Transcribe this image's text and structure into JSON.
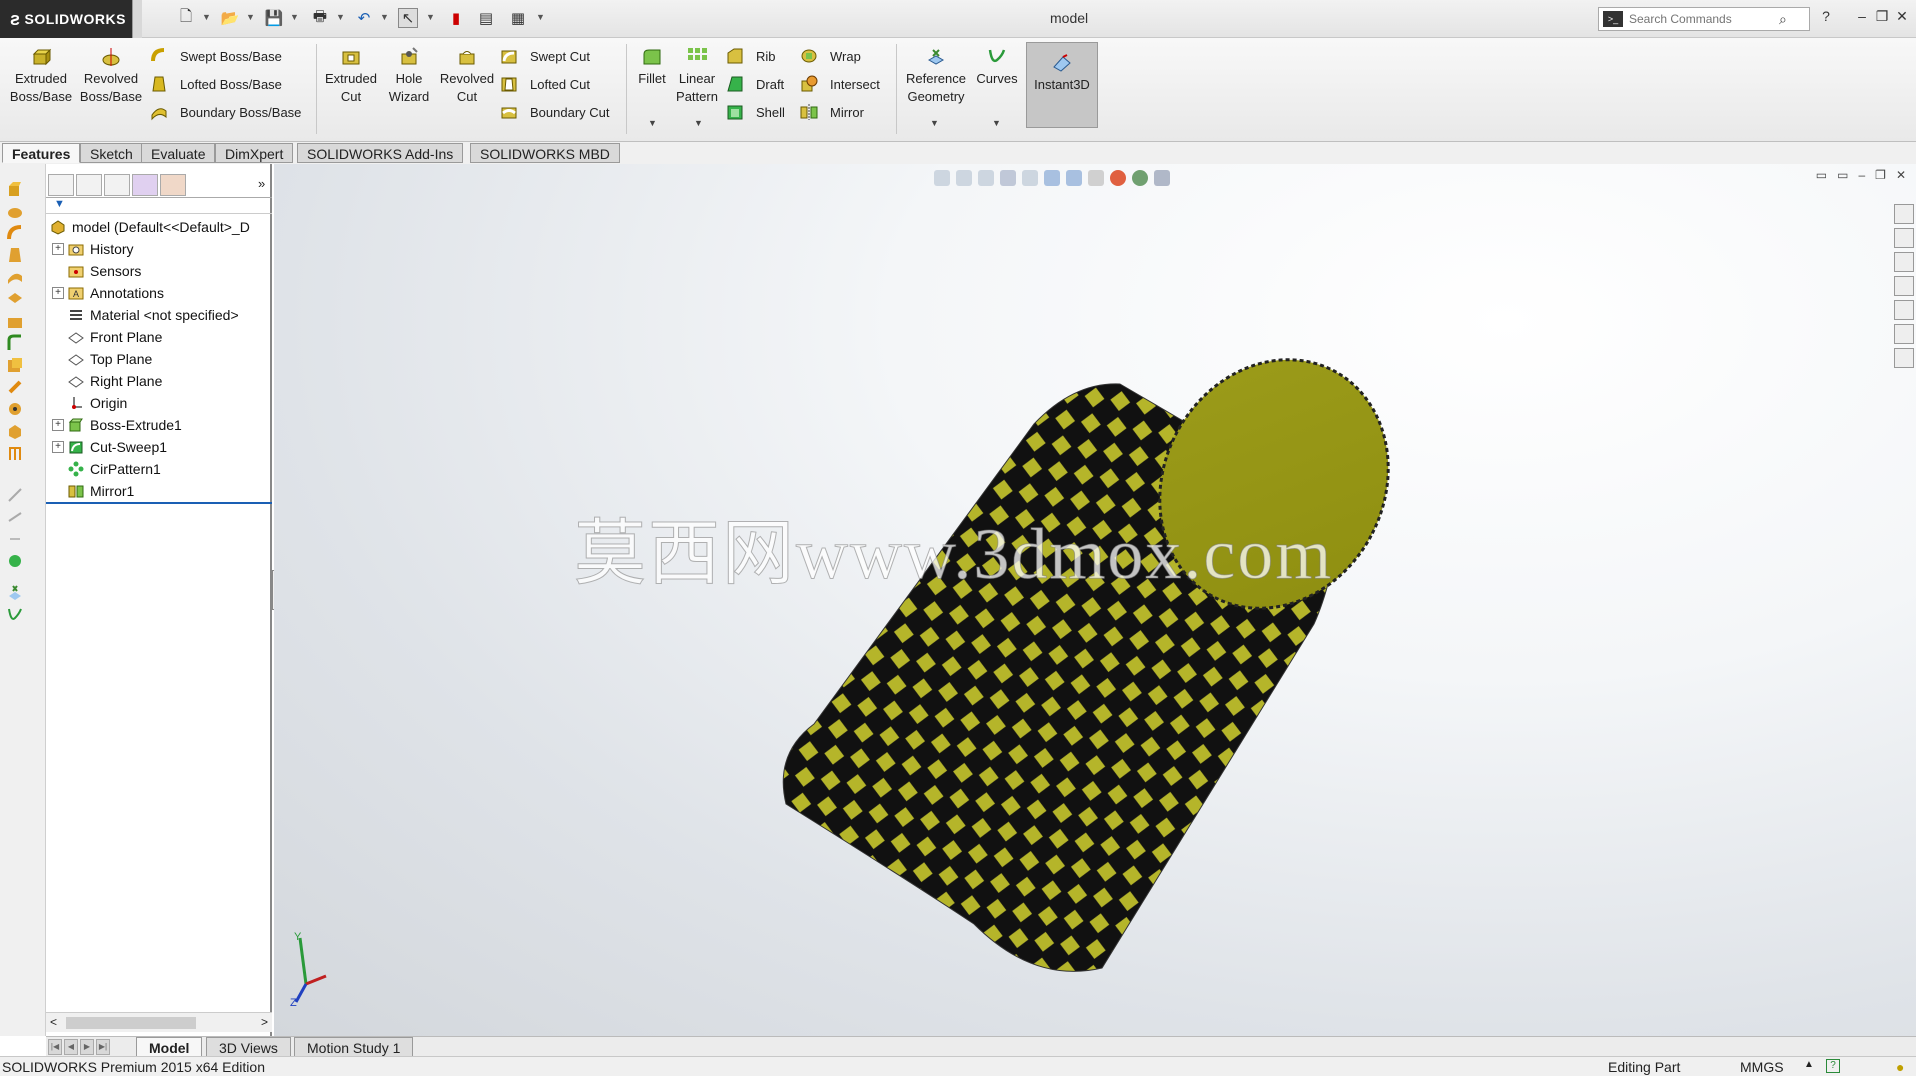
{
  "app": {
    "brand": "SOLIDWORKS",
    "title": "model"
  },
  "search": {
    "placeholder": "Search Commands"
  },
  "ribbon": {
    "extruded_boss": "Extruded Boss/Base",
    "revolved_boss": "Revolved Boss/Base",
    "swept_boss": "Swept Boss/Base",
    "lofted_boss": "Lofted Boss/Base",
    "boundary_boss": "Boundary Boss/Base",
    "extruded_cut": "Extruded Cut",
    "hole_wizard": "Hole Wizard",
    "revolved_cut": "Revolved Cut",
    "swept_cut": "Swept Cut",
    "lofted_cut": "Lofted Cut",
    "boundary_cut": "Boundary Cut",
    "fillet": "Fillet",
    "linear_pattern": "Linear Pattern",
    "rib": "Rib",
    "draft": "Draft",
    "shell": "Shell",
    "wrap": "Wrap",
    "intersect": "Intersect",
    "mirror": "Mirror",
    "reference_geometry": "Reference Geometry",
    "curves": "Curves",
    "instant3d": "Instant3D"
  },
  "cm_tabs": [
    "Features",
    "Sketch",
    "Evaluate",
    "DimXpert",
    "SOLIDWORKS Add-Ins",
    "SOLIDWORKS MBD"
  ],
  "tree": {
    "root": "model  (Default<<Default>_D",
    "items": [
      {
        "label": "History",
        "expandable": true
      },
      {
        "label": "Sensors",
        "expandable": false
      },
      {
        "label": "Annotations",
        "expandable": true
      },
      {
        "label": "Material <not specified>",
        "expandable": false
      },
      {
        "label": "Front Plane",
        "expandable": false
      },
      {
        "label": "Top Plane",
        "expandable": false
      },
      {
        "label": "Right Plane",
        "expandable": false
      },
      {
        "label": "Origin",
        "expandable": false
      },
      {
        "label": "Boss-Extrude1",
        "expandable": true
      },
      {
        "label": "Cut-Sweep1",
        "expandable": true
      },
      {
        "label": "CirPattern1",
        "expandable": false
      },
      {
        "label": "Mirror1",
        "expandable": false
      }
    ]
  },
  "watermark": "莫西网www.3dmox.com",
  "triad": {
    "y_label": "Y",
    "z_label": "Z"
  },
  "bottom_tabs": [
    "Model",
    "3D Views",
    "Motion Study 1"
  ],
  "status": {
    "edition": "SOLIDWORKS Premium 2015 x64 Edition",
    "mode": "Editing Part",
    "units": "MMGS"
  },
  "colors": {
    "part_yellow": "#b5b52a",
    "part_shadow": "#6f6f10",
    "knurl_black": "#111111",
    "accent_blue": "#1a5fb4"
  }
}
